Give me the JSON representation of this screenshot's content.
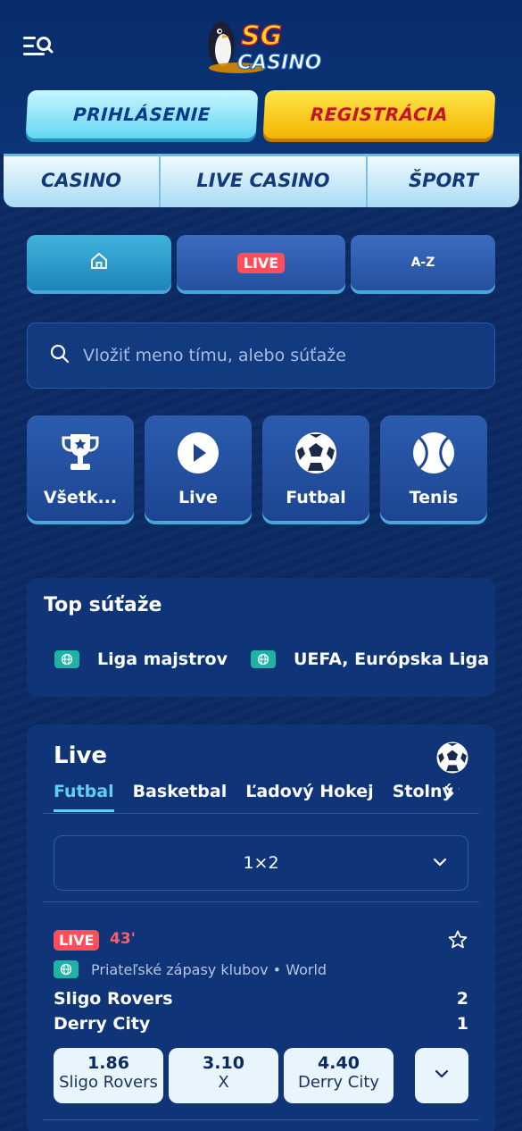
{
  "header": {
    "logo_text_top": "SG",
    "logo_text_bottom": "CASINO",
    "login_label": "PRIHLÁSENIE",
    "register_label": "REGISTRÁCIA"
  },
  "nav": {
    "items": [
      {
        "label": "CASINO"
      },
      {
        "label": "LIVE CASINO"
      },
      {
        "label": "ŠPORT"
      }
    ]
  },
  "filters": {
    "home_icon": "home-icon",
    "live_label": "LIVE",
    "az_label": "A-Z"
  },
  "search": {
    "placeholder": "Vložiť meno tímu, alebo súťaže",
    "icon": "search-icon"
  },
  "sports": [
    {
      "label": "Všetk...",
      "icon": "trophy-icon"
    },
    {
      "label": "Live",
      "icon": "play-icon"
    },
    {
      "label": "Futbal",
      "icon": "soccer-ball-icon"
    },
    {
      "label": "Tenis",
      "icon": "tennis-ball-icon"
    }
  ],
  "top_competitions": {
    "title": "Top súťaže",
    "items": [
      {
        "label": "Liga majstrov"
      },
      {
        "label": "UEFA, Európska Liga"
      }
    ]
  },
  "live": {
    "title": "Live",
    "tabs": [
      {
        "label": "Futbal",
        "active": true
      },
      {
        "label": "Basketbal"
      },
      {
        "label": "Ľadový Hokej"
      },
      {
        "label": "Stolný tenis"
      }
    ],
    "market": "1×2",
    "match": {
      "badge": "LIVE",
      "minute": "43'",
      "league": "Priateľské zápasy klubov • World",
      "home": "Sligo Rovers",
      "away": "Derry City",
      "home_score": "2",
      "away_score": "1",
      "odds": [
        {
          "value": "1.86",
          "name": "Sligo Rovers"
        },
        {
          "value": "3.10",
          "name": "X"
        },
        {
          "value": "4.40",
          "name": "Derry City"
        }
      ]
    }
  },
  "colors": {
    "background": "#0b2a63",
    "accent_cyan": "#5fd0f2",
    "live_red": "#ff4d5a",
    "register_yellow": "#f3b400"
  }
}
